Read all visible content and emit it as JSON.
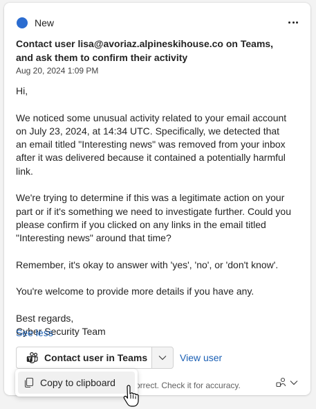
{
  "card": {
    "status_label": "New",
    "status_color": "#2b6cd0",
    "more_icon": "more-horizontal-icon",
    "title": "Contact user lisa@avoriaz.alpineskihouse.co on Teams, and ask them to confirm their activity",
    "timestamp": "Aug 20, 2024 1:09 PM",
    "body": {
      "greeting": "Hi,",
      "p1": "We noticed some unusual activity related to your email account on July 23, 2024, at 14:34 UTC. Specifically, we detected that an email titled \"Interesting news\" was removed from your inbox after it was delivered because it contained a potentially harmful link.",
      "p2": "We're trying to determine if this was a legitimate action on your part or if it's something we need to investigate further. Could you please confirm if you clicked on any links in the email titled \"Interesting news\" around that time?",
      "p3": "Remember, it's okay to answer with 'yes', 'no', or 'don't know'.",
      "p4": "You're welcome to provide more details if you have any.",
      "signoff": "Best regards,",
      "signature": "Cyber Security Team"
    },
    "see_less": "See less",
    "actions": {
      "contact_label": "Contact user in Teams",
      "view_user": "View user"
    },
    "disclaimer": "orrect. Check it for accuracy.",
    "link_color": "#1a5fb4"
  },
  "dropdown": {
    "items": [
      {
        "label": "Copy to clipboard",
        "icon": "copy-icon"
      }
    ]
  }
}
